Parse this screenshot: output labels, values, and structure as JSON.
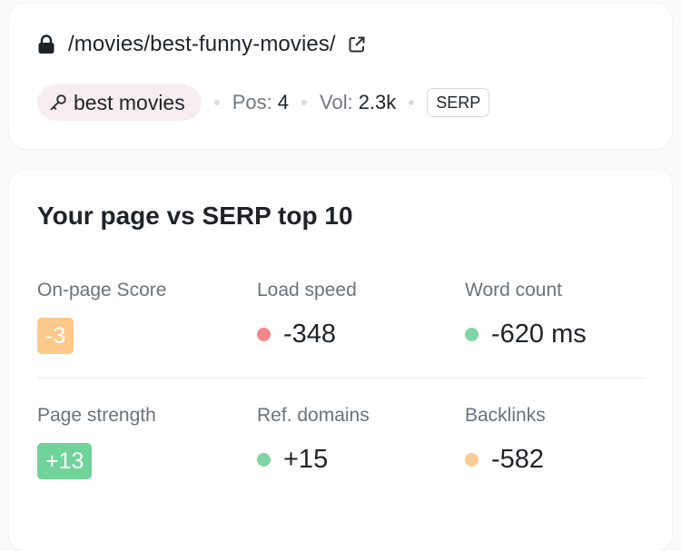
{
  "page": {
    "url_path": "/movies/best-funny-movies/",
    "keyword": "best movies",
    "pos_label": "Pos:",
    "pos_value": "4",
    "vol_label": "Vol:",
    "vol_value": "2.3k",
    "serp_label": "SERP"
  },
  "comparison": {
    "title": "Your page vs SERP top 10",
    "metrics": [
      {
        "label": "On-page Score",
        "value": "-3",
        "style": "badge",
        "color": "#fcc98a"
      },
      {
        "label": "Load speed",
        "value": "-348",
        "style": "dot",
        "color": "#f2868a"
      },
      {
        "label": "Word count",
        "value": "-620 ms",
        "style": "dot",
        "color": "#7fd6a4"
      },
      {
        "label": "Page strength",
        "value": "+13",
        "style": "badge",
        "color": "#6fd39a"
      },
      {
        "label": "Ref. domains",
        "value": "+15",
        "style": "dot",
        "color": "#7fd6a4"
      },
      {
        "label": "Backlinks",
        "value": "-582",
        "style": "dot",
        "color": "#f9cc92"
      }
    ]
  },
  "icons": {
    "lock": "lock-icon",
    "external": "external-link-icon",
    "key": "key-icon"
  }
}
